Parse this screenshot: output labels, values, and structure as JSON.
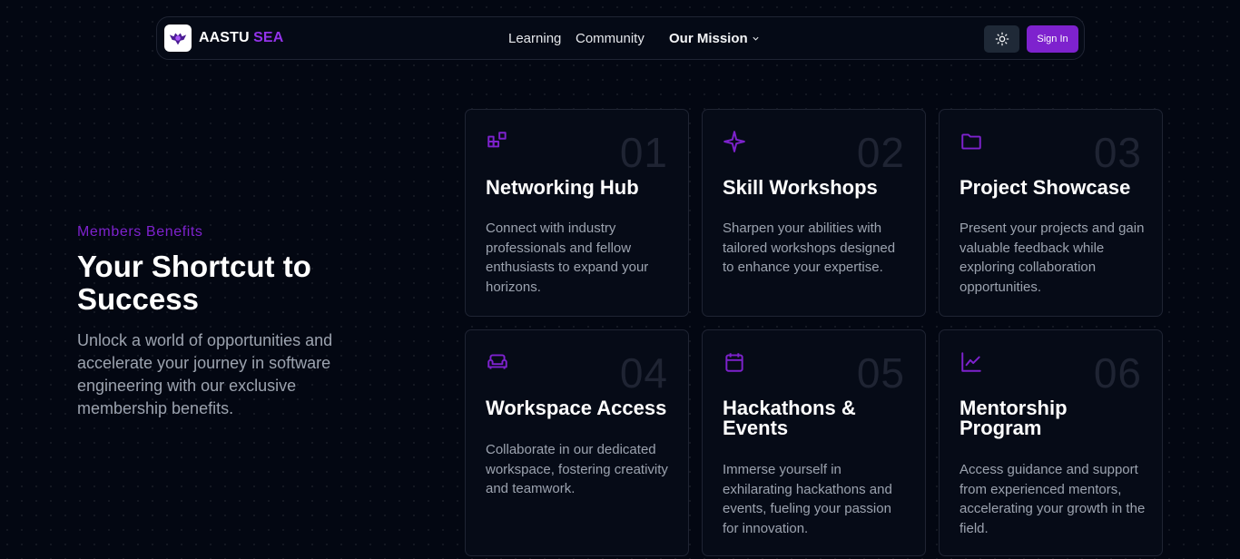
{
  "nav": {
    "brand_primary": "AASTU",
    "brand_secondary": "SEA",
    "links": [
      "Learning",
      "Community"
    ],
    "mission_label": "Our Mission",
    "signin_label": "Sign In"
  },
  "hero": {
    "eyebrow": "Members Benefits",
    "title": "Your Shortcut to Success",
    "subtitle": "Unlock a world of opportunities and accelerate your journey in software engineering with our exclusive membership benefits."
  },
  "cards": [
    {
      "num": "01",
      "title": "Networking Hub",
      "desc": "Connect with industry professionals and fellow enthusiasts to expand your horizons.",
      "icon": "blocks-icon"
    },
    {
      "num": "02",
      "title": "Skill Workshops",
      "desc": "Sharpen your abilities with tailored workshops designed to enhance your expertise.",
      "icon": "sparkle-icon"
    },
    {
      "num": "03",
      "title": "Project Showcase",
      "desc": "Present your projects and gain valuable feedback while exploring collaboration opportunities.",
      "icon": "folder-icon"
    },
    {
      "num": "04",
      "title": "Workspace Access",
      "desc": "Collaborate in our dedicated workspace, fostering creativity and teamwork.",
      "icon": "sofa-icon"
    },
    {
      "num": "05",
      "title": "Hackathons & Events",
      "desc": "Immerse yourself in exhilarating hackathons and events, fueling your passion for innovation.",
      "icon": "calendar-icon"
    },
    {
      "num": "06",
      "title": "Mentorship Program",
      "desc": "Access guidance and support from experienced mentors, accelerating your growth in the field.",
      "icon": "chart-line-icon"
    }
  ],
  "colors": {
    "accent": "#7e22ce",
    "background": "#030712",
    "card_border": "#1f2433",
    "muted_text": "#9ca3af"
  }
}
